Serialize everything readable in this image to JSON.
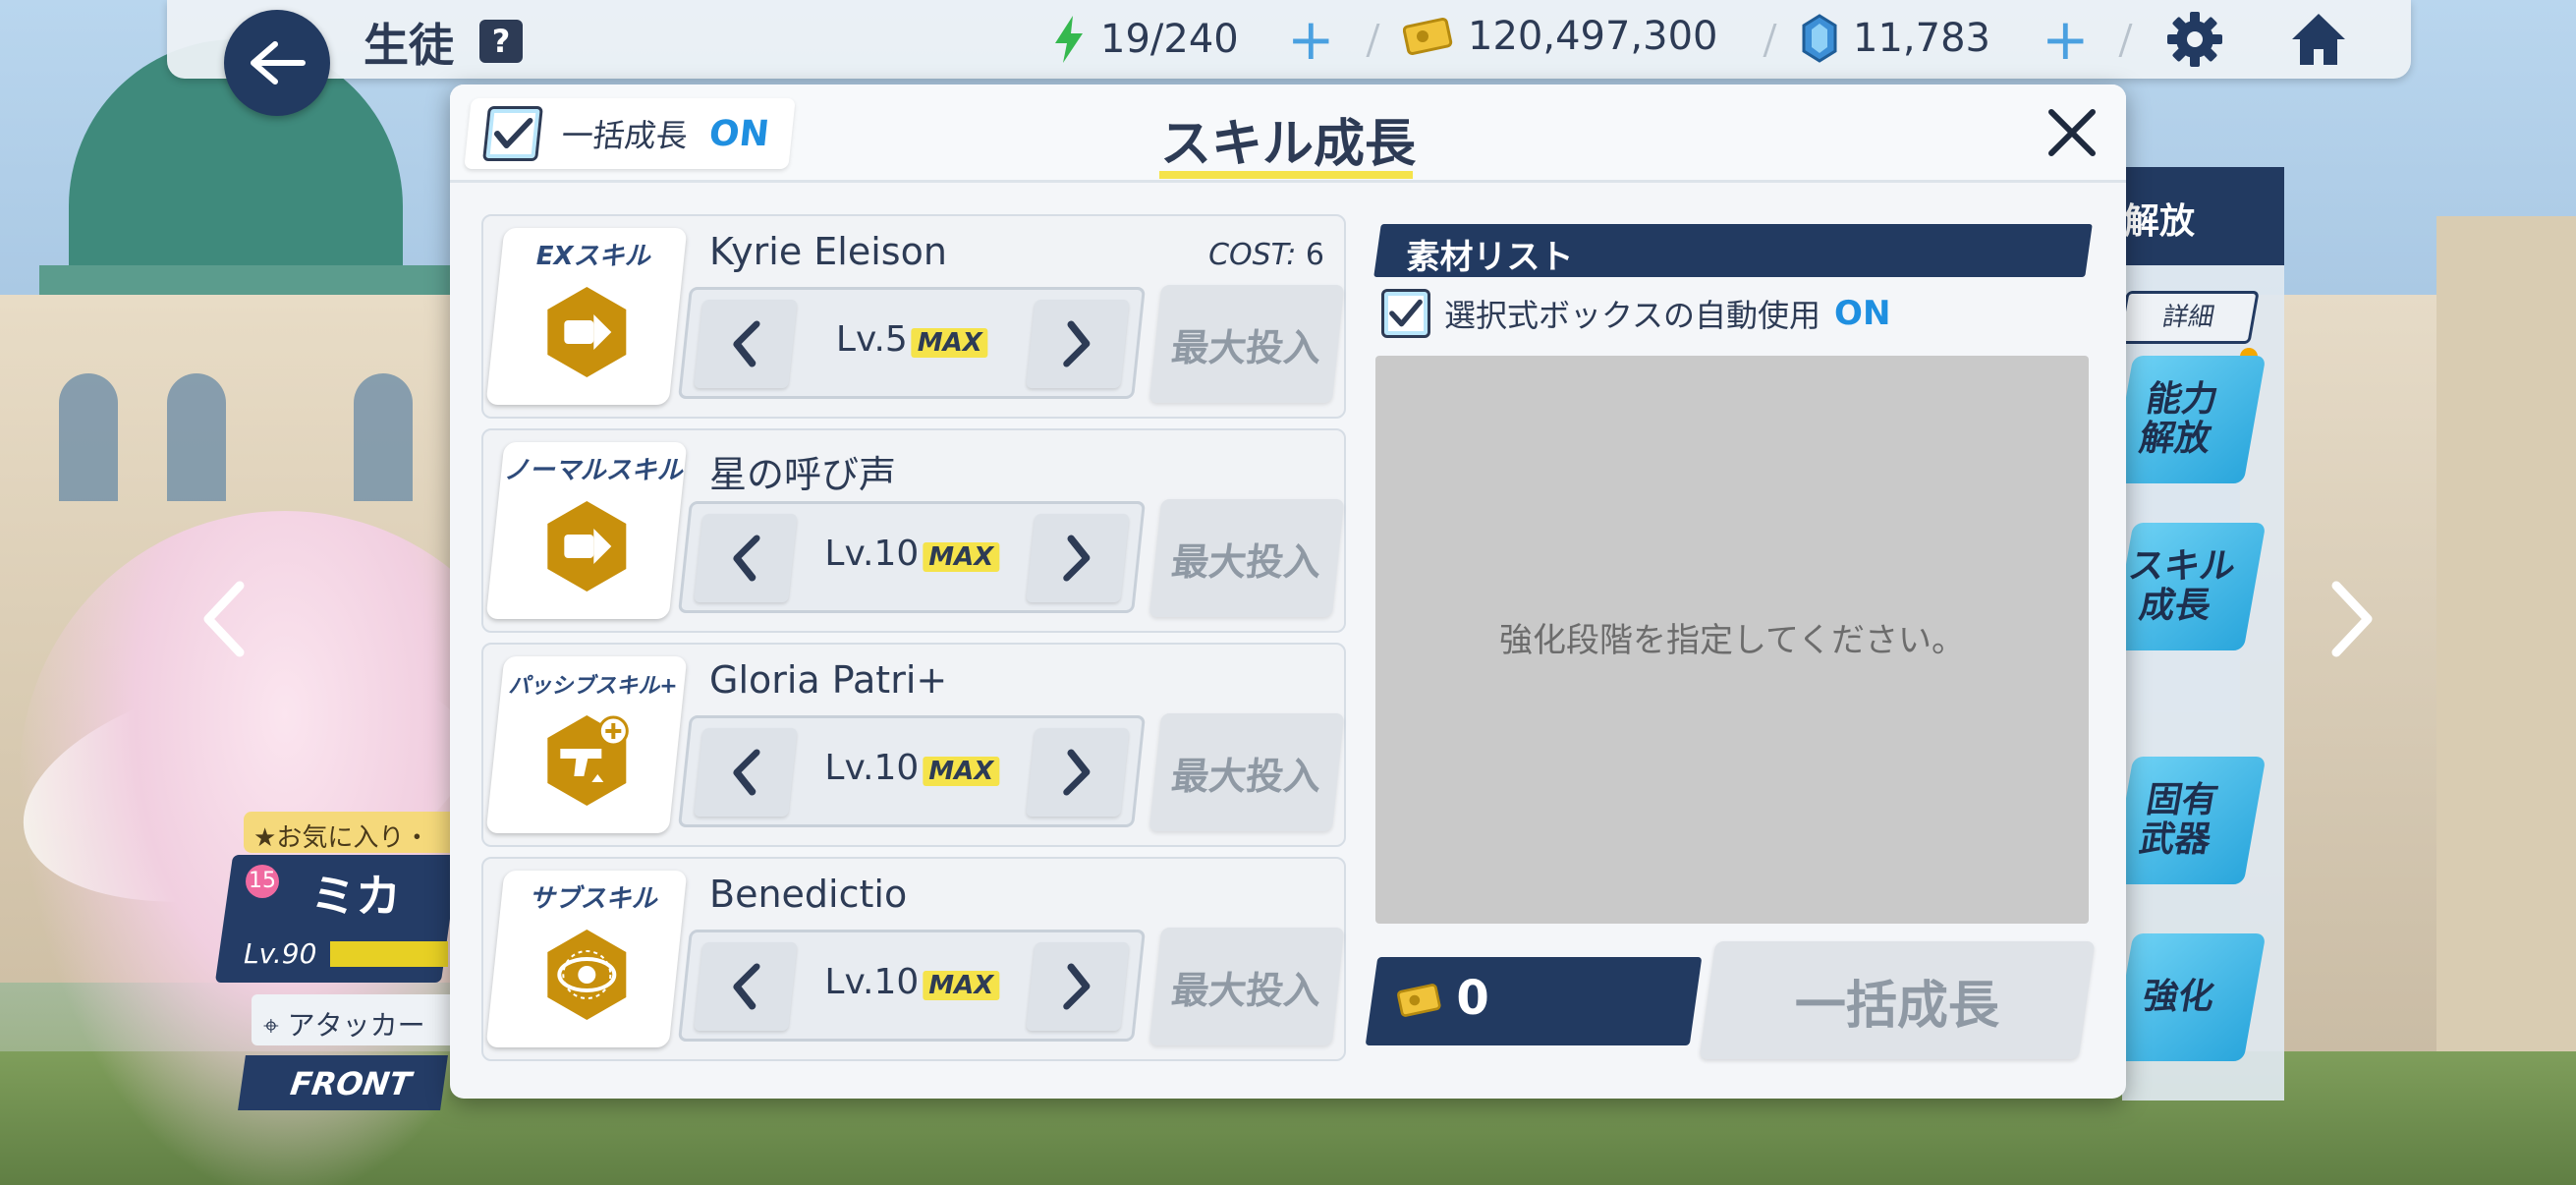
{
  "topbar": {
    "title": "生徒",
    "help": "?",
    "ap": "19/240",
    "credits": "120,497,300",
    "pyroxene": "11,783"
  },
  "character": {
    "favorite": "お気に入り・",
    "level_badge": "15",
    "name": "ミカ",
    "level": "Lv.90",
    "role": "アタッカー",
    "position": "FRONT"
  },
  "right_menu": {
    "header": "解放",
    "detail": "詳細",
    "buttons": [
      "能力\n解放",
      "スキル\n成長",
      "固有\n武器",
      "強化"
    ]
  },
  "modal": {
    "title": "スキル成長",
    "bulk_label": "一括成長",
    "bulk_state": "ON",
    "skills": [
      {
        "type": "EXスキル",
        "name": "Kyrie Eleison",
        "cost_label": "COST:",
        "cost": "6",
        "level": "Lv.5",
        "max": "MAX",
        "max_input": "最大投入"
      },
      {
        "type": "ノーマルスキル",
        "name": "星の呼び声",
        "level": "Lv.10",
        "max": "MAX",
        "max_input": "最大投入"
      },
      {
        "type": "パッシブスキル+",
        "name": "Gloria Patri+",
        "level": "Lv.10",
        "max": "MAX",
        "max_input": "最大投入"
      },
      {
        "type": "サブスキル",
        "name": "Benedictio",
        "level": "Lv.10",
        "max": "MAX",
        "max_input": "最大投入"
      }
    ],
    "materials": {
      "header": "素材リスト",
      "auto_label": "選択式ボックスの自動使用",
      "auto_state": "ON",
      "empty_message": "強化段階を指定してください。"
    },
    "credit_cost": "0",
    "bulk_grow_button": "一括成長"
  },
  "colors": {
    "navy": "#223a61",
    "accent_blue": "#1f8fe0",
    "skill_gold": "#c8900c",
    "underline_yellow": "#f5e34a"
  },
  "icons": [
    "back-arrow-icon",
    "help-icon",
    "ap-bolt-icon",
    "credit-icon",
    "pyroxene-icon",
    "gear-icon",
    "home-icon",
    "close-icon",
    "check-icon",
    "chevron-left-icon",
    "chevron-right-icon"
  ]
}
